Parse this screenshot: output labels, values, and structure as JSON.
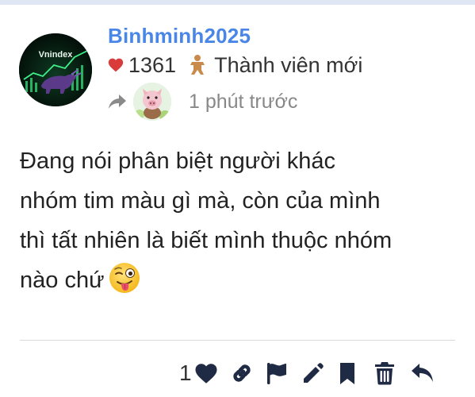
{
  "post": {
    "username": "Binhminh2025",
    "like_total": "1361",
    "member_title": "Thành viên mới",
    "time_ago": "1 phút trước",
    "avatar_text": "Vnindex",
    "body_lines": [
      "Đang nói phân biệt người khác",
      "nhóm tim màu gì mà, còn của mình",
      "thì tất nhiên là biết mình thuộc nhóm",
      "nào chứ"
    ],
    "emoji": "winking-face-with-tongue"
  },
  "actions": {
    "like_count": "1",
    "icons": [
      "heart-icon",
      "link-icon",
      "flag-icon",
      "pencil-icon",
      "bookmark-icon",
      "trash-icon",
      "reply-icon"
    ]
  },
  "colors": {
    "username": "#4a86e8",
    "heart": "#d93a3a",
    "muted_text": "#888888",
    "action_icon": "#1f2a44",
    "top_rule": "#dfe7f5"
  }
}
